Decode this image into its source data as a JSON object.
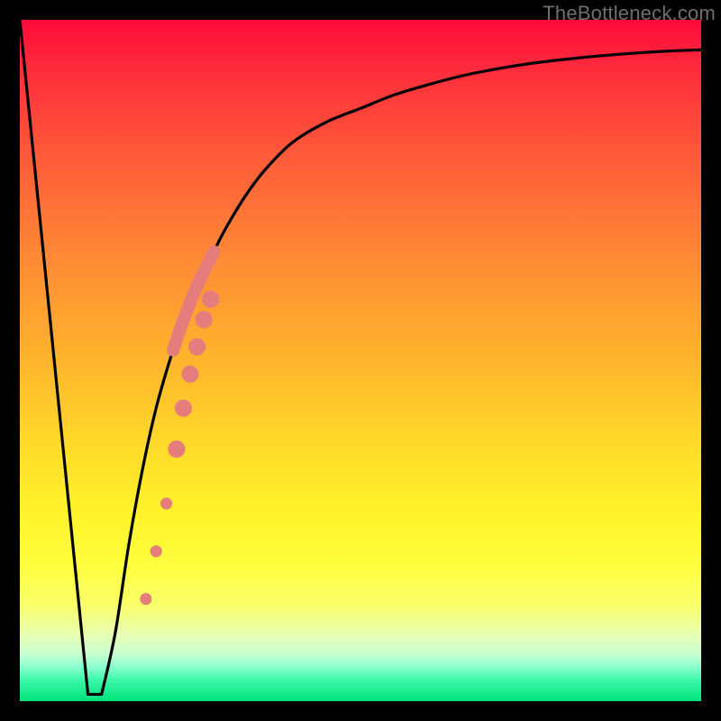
{
  "watermark": "TheBottleneck.com",
  "colors": {
    "frame": "#000000",
    "curve": "#000000",
    "markers": "#e57d7d",
    "gradient_top": "#ff0a3a",
    "gradient_bottom": "#00e27a"
  },
  "chart_data": {
    "type": "line",
    "title": "",
    "xlabel": "",
    "ylabel": "",
    "xlim": [
      0,
      100
    ],
    "ylim": [
      0,
      100
    ],
    "grid": false,
    "legend": false,
    "series": [
      {
        "name": "bottleneck-curve",
        "x": [
          0,
          2,
          4,
          6,
          8,
          10,
          11,
          12,
          14,
          16,
          18,
          20,
          22,
          24,
          26,
          28,
          30,
          33,
          36,
          40,
          45,
          50,
          55,
          60,
          65,
          70,
          75,
          80,
          85,
          90,
          95,
          100
        ],
        "values": [
          100,
          80,
          60,
          40,
          20,
          2,
          1,
          1,
          10,
          23,
          34,
          43,
          50,
          56,
          61,
          65,
          69,
          74,
          78,
          82,
          85,
          87,
          89,
          90.5,
          91.8,
          92.8,
          93.6,
          94.2,
          94.7,
          95.1,
          95.4,
          95.6
        ]
      }
    ],
    "flat_bottom": {
      "x_start": 10,
      "x_end": 12,
      "value": 1
    },
    "markers": {
      "name": "highlighted-points",
      "color": "#e57d7d",
      "points": [
        {
          "x": 18.5,
          "y": 15,
          "r": 1.1
        },
        {
          "x": 20.0,
          "y": 22,
          "r": 1.1
        },
        {
          "x": 21.5,
          "y": 29,
          "r": 1.1
        },
        {
          "x": 23.0,
          "y": 37,
          "r": 1.6
        },
        {
          "x": 24.0,
          "y": 43,
          "r": 1.6
        },
        {
          "x": 25.0,
          "y": 48,
          "r": 1.6
        },
        {
          "x": 26.0,
          "y": 52,
          "r": 1.6
        },
        {
          "x": 27.0,
          "y": 56,
          "r": 1.6
        },
        {
          "x": 28.0,
          "y": 59,
          "r": 1.6
        }
      ]
    }
  }
}
